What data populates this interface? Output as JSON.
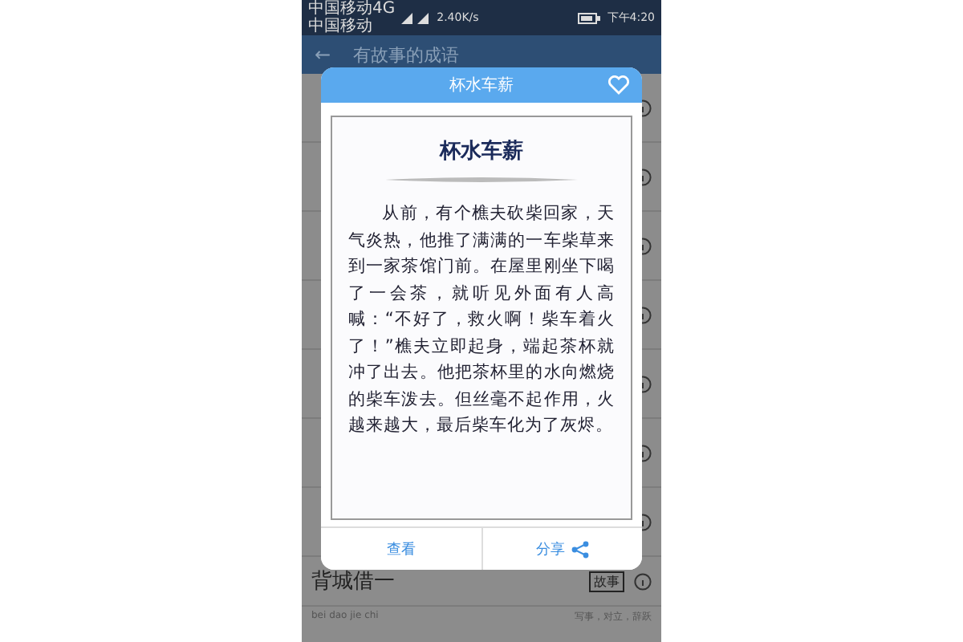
{
  "status_bar": {
    "carrier_top": "中国移动4G",
    "carrier_bottom": "中国移动",
    "speed": "2.40K/s",
    "time": "下午4:20"
  },
  "header": {
    "back": "←",
    "title": "有故事的成语"
  },
  "dialog": {
    "title": "杯水车薪",
    "favorite": false,
    "heading": "杯水车薪",
    "story": "从前，有个樵夫砍柴回家，天气炎热，他推了满满的一车柴草来到一家茶馆门前。在屋里刚坐下喝了一会茶，就听见外面有人高喊：“不好了，救火啊！柴车着火了！”樵夫立即起身，端起茶杯就冲了出去。他把茶杯里的水向燃烧的柴车泼去。但丝毫不起作用，火越来越大，最后柴车化为了灰烬。",
    "buttons": [
      {
        "label": "查看",
        "kind": "plain"
      },
      {
        "label": "分享",
        "kind": "share"
      }
    ]
  },
  "bottom_row": {
    "title": "背城借一",
    "tag": "故事",
    "pinyin": "bei dao jie chi",
    "note": "写事，对立，辞跃"
  }
}
